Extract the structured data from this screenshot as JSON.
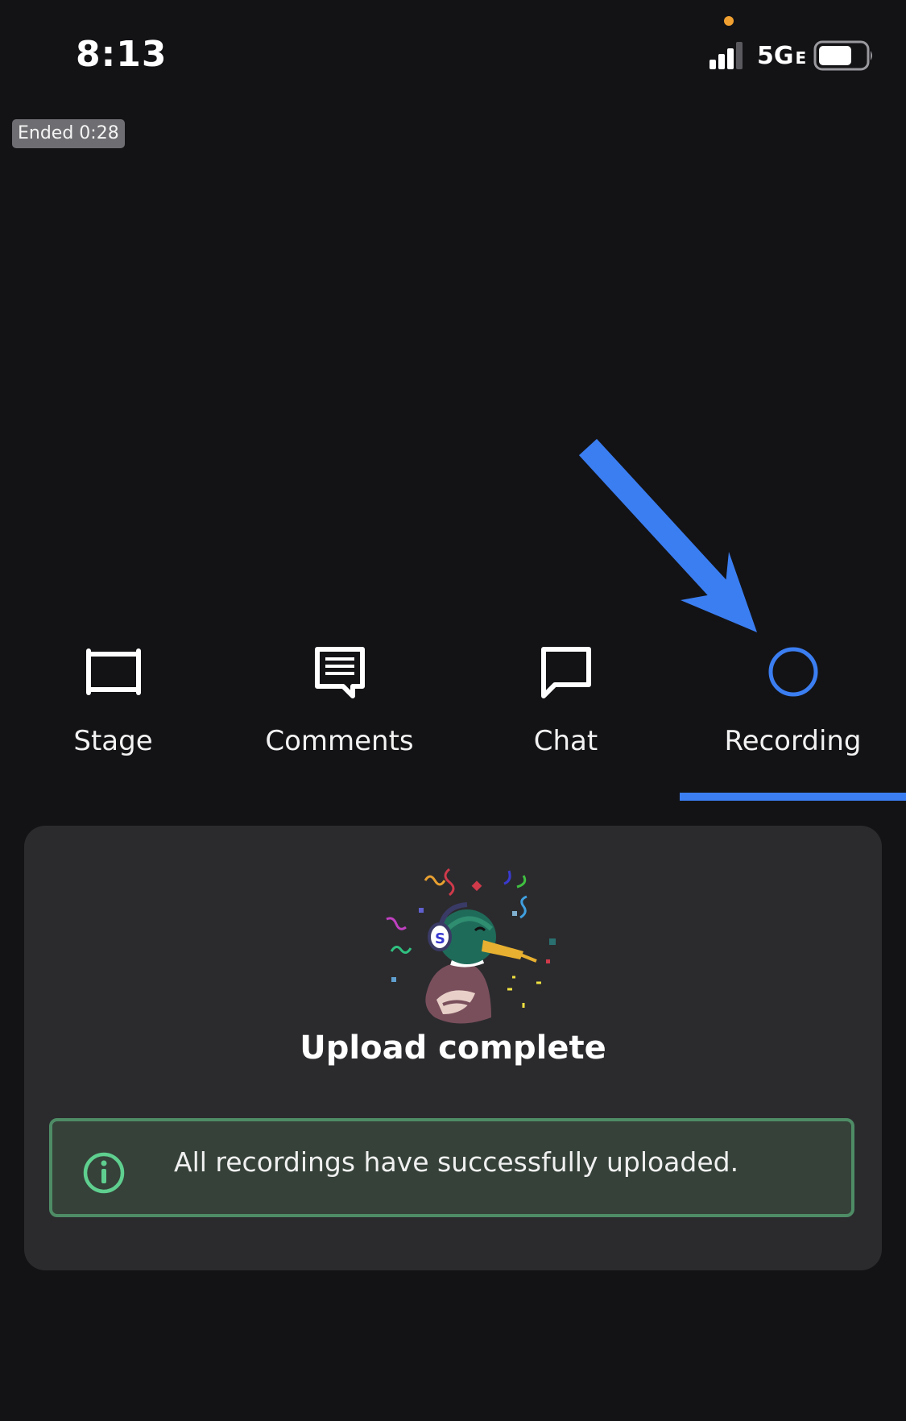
{
  "status_bar": {
    "time": "8:13",
    "network": "5G",
    "network_sub": "E",
    "battery_icon": "battery-icon",
    "signal_icon": "signal-bars-icon"
  },
  "session": {
    "ended_label": "Ended 0:28"
  },
  "tabs": [
    {
      "label": "Stage",
      "icon": "stage-icon",
      "active": false
    },
    {
      "label": "Comments",
      "icon": "comments-icon",
      "active": false
    },
    {
      "label": "Chat",
      "icon": "chat-icon",
      "active": false
    },
    {
      "label": "Recording",
      "icon": "record-circle-icon",
      "active": true
    }
  ],
  "upload_card": {
    "illustration": "celebrating-duck-illustration",
    "title": "Upload complete",
    "info_icon": "info-icon",
    "message": "All recordings have successfully uploaded."
  },
  "colors": {
    "background": "#131316",
    "accent": "#3b7ef2",
    "card": "#2b2b2e",
    "success_border": "#4e8c66",
    "success_bg": "#354139"
  }
}
